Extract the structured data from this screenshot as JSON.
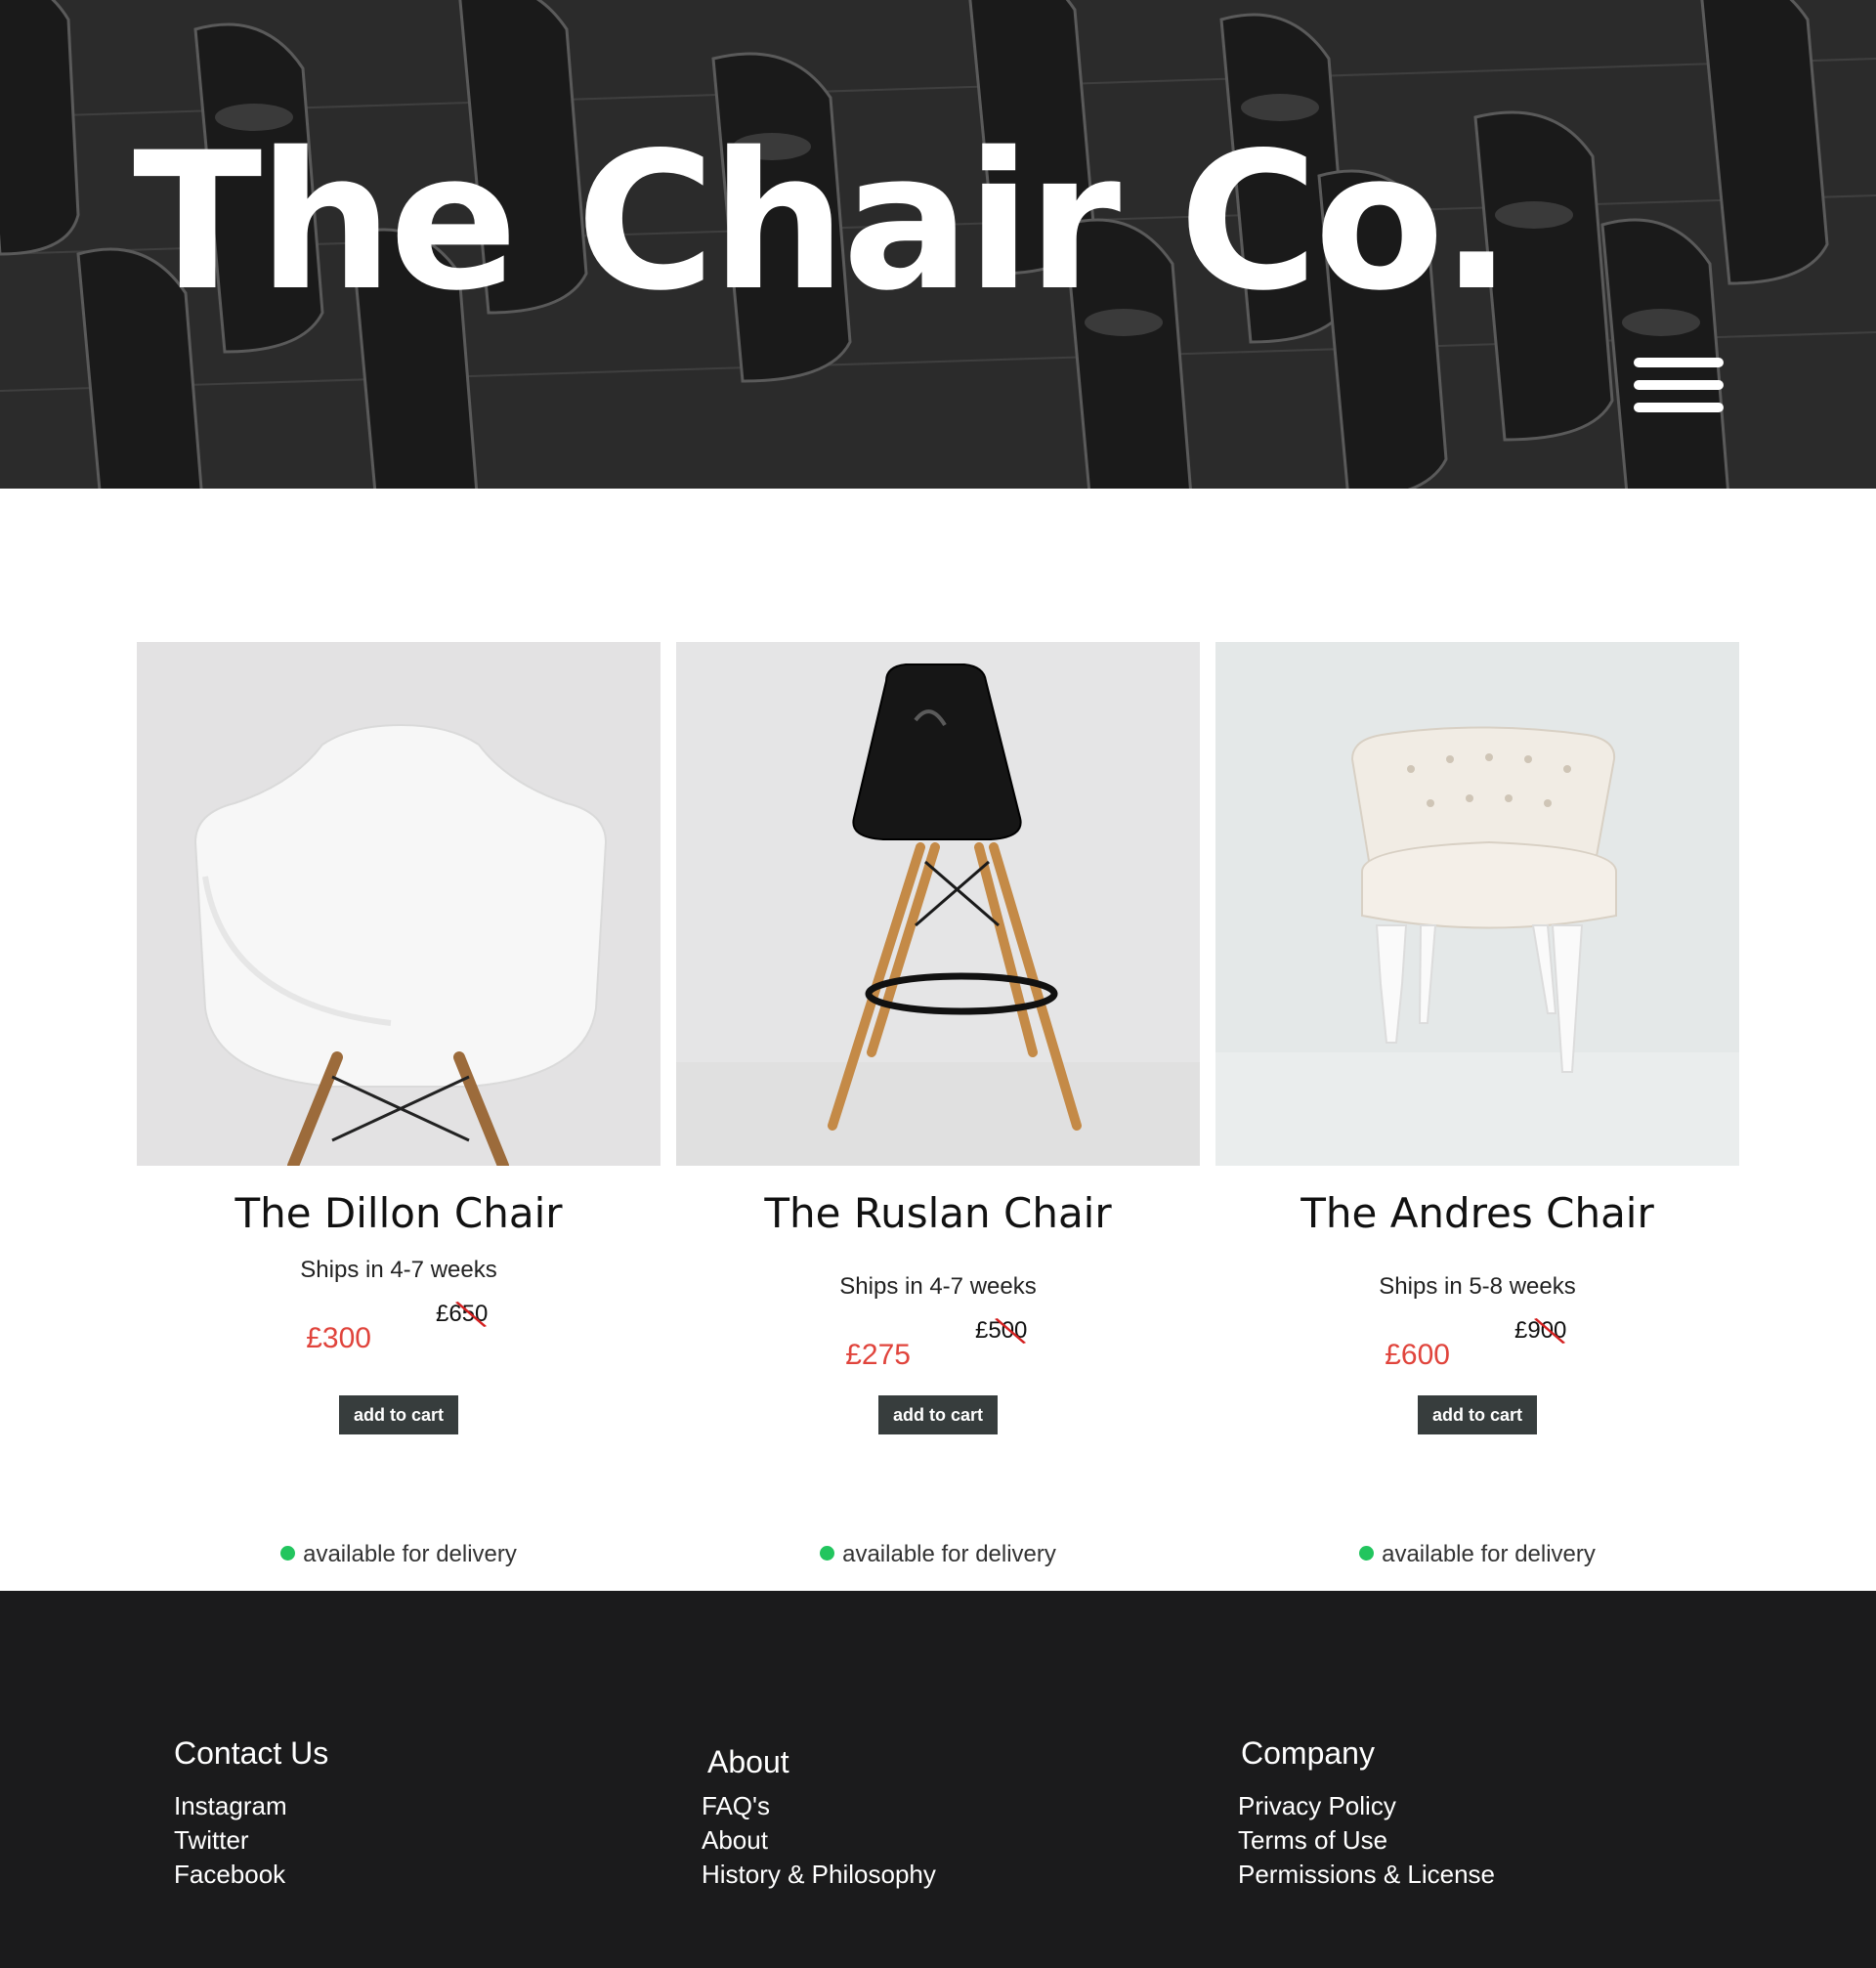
{
  "hero": {
    "title": "The Chair Co.",
    "menu_icon": "hamburger-menu-icon"
  },
  "products": [
    {
      "name": "The Dillon Chair",
      "shipping": "Ships in 4-7 weeks",
      "price": "£300",
      "original_price": "£650",
      "add_to_cart": "add to cart",
      "availability": "available for delivery",
      "image": "white-armchair-photo"
    },
    {
      "name": "The Ruslan Chair",
      "shipping": "Ships in 4-7 weeks",
      "price": "£275",
      "original_price": "£500",
      "add_to_cart": "add to cart",
      "availability": "available for delivery",
      "image": "black-bar-stool-photo"
    },
    {
      "name": "The Andres Chair",
      "shipping": "Ships in 5-8 weeks",
      "price": "£600",
      "original_price": "£900",
      "add_to_cart": "add to cart",
      "availability": "available for delivery",
      "image": "tufted-cream-armchair-photo"
    }
  ],
  "footer": {
    "columns": [
      {
        "heading": "Contact Us",
        "links": [
          "Instagram",
          "Twitter",
          "Facebook"
        ]
      },
      {
        "heading": "About",
        "links": [
          "FAQ's",
          "About",
          "History & Philosophy"
        ]
      },
      {
        "heading": "Company",
        "links": [
          "Privacy Policy",
          "Terms of Use",
          "Permissions & License"
        ]
      }
    ]
  },
  "colors": {
    "sale_price": "#e0443c",
    "strike": "#d42020",
    "button_bg": "#373d3d",
    "status_available": "#22c55e",
    "footer_bg": "#1b1b1c"
  }
}
